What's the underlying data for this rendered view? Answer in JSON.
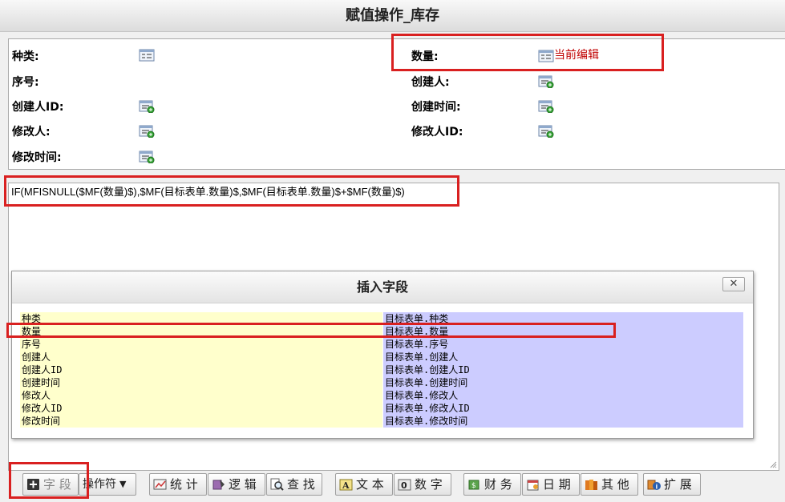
{
  "window": {
    "title": "赋值操作_库存"
  },
  "fields": {
    "left": [
      {
        "label": "种类:"
      },
      {
        "label": "序号:"
      },
      {
        "label": "创建人ID:"
      },
      {
        "label": "修改人:"
      },
      {
        "label": "修改时间:"
      }
    ],
    "right": [
      {
        "label": "数量:",
        "annotation": "当前编辑"
      },
      {
        "label": "创建人:"
      },
      {
        "label": "创建时间:"
      },
      {
        "label": "修改人ID:"
      }
    ]
  },
  "editor": {
    "formula": "IF(MFISNULL($MF(数量)$),$MF(目标表单.数量)$,$MF(目标表单.数量)$+$MF(数量)$)"
  },
  "dialog": {
    "title": "插入字段",
    "close_label": "✕",
    "left_items": [
      "种类",
      "数量",
      "序号",
      "创建人",
      "创建人ID",
      "创建时间",
      "修改人",
      "修改人ID",
      "修改时间"
    ],
    "right_items": [
      "目标表单.种类",
      "目标表单.数量",
      "目标表单.序号",
      "目标表单.创建人",
      "目标表单.创建人ID",
      "目标表单.创建时间",
      "目标表单.修改人",
      "目标表单.修改人ID",
      "目标表单.修改时间"
    ]
  },
  "toolbar": {
    "field_label": "字 段",
    "operator_label": "操作符",
    "stats_label": "统 计",
    "logic_label": "逻 辑",
    "find_label": "查 找",
    "text_label": "文 本",
    "number_label": "数 字",
    "finance_label": "财 务",
    "date_label": "日 期",
    "other_label": "其 他",
    "extend_label": "扩 展"
  },
  "colors": {
    "highlight_red": "#d92020",
    "list_left_bg": "#ffffcc",
    "list_right_bg": "#ccccff"
  }
}
